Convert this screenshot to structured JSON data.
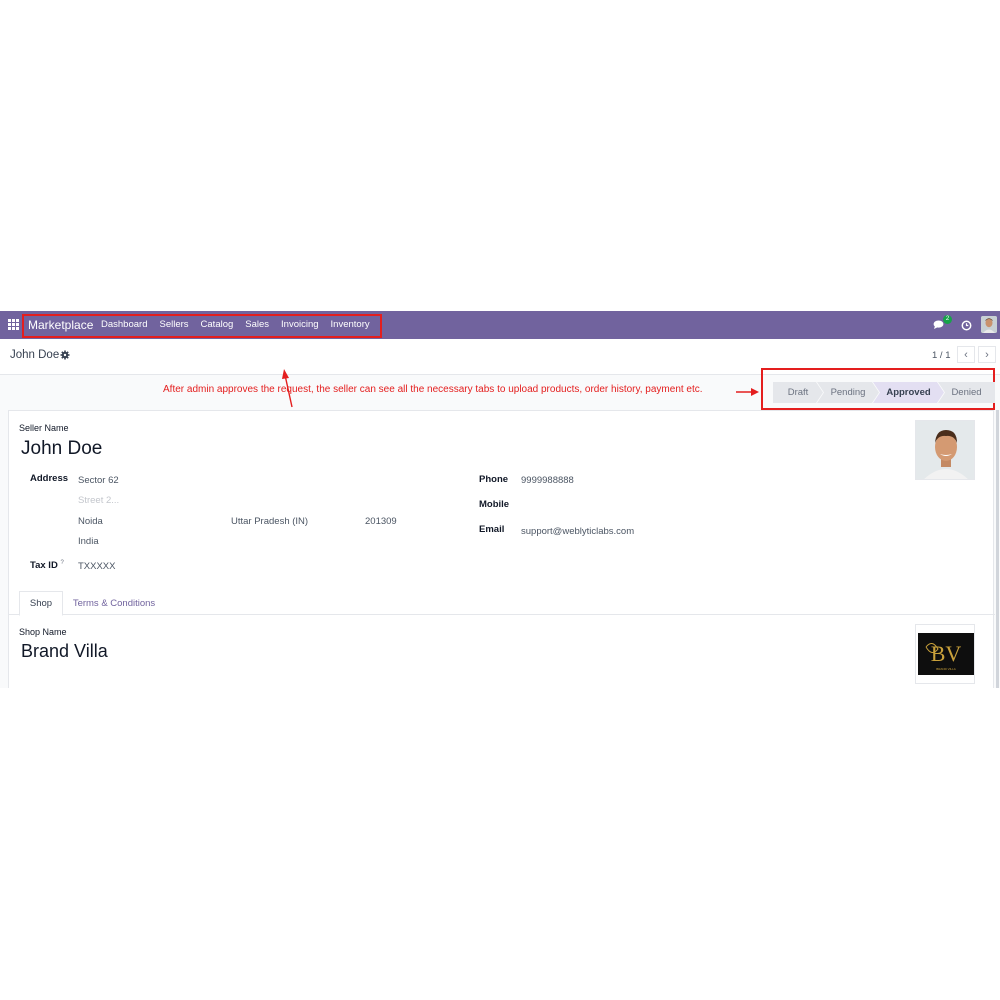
{
  "navbar": {
    "brand": "Marketplace",
    "menu": [
      "Dashboard",
      "Sellers",
      "Catalog",
      "Sales",
      "Invoicing",
      "Inventory"
    ],
    "chat_badge": "2",
    "color": "#71639e"
  },
  "control": {
    "record_title": "John Doe",
    "pager": "1 / 1",
    "prev_icon": "chevron-left-icon",
    "next_icon": "chevron-right-icon"
  },
  "annotation": {
    "text": "After admin approves the request, the seller can see all the necessary tabs to upload products, order history, payment etc.",
    "color": "#e41e1e"
  },
  "status": {
    "stages": [
      "Draft",
      "Pending",
      "Approved",
      "Denied"
    ],
    "current": "Approved"
  },
  "form": {
    "seller_name_label": "Seller Name",
    "seller_name": "John Doe",
    "address_label": "Address",
    "street": "Sector 62",
    "street2_placeholder": "Street 2...",
    "city": "Noida",
    "state": "Uttar Pradesh (IN)",
    "zip": "201309",
    "country": "India",
    "tax_id_label": "Tax ID",
    "tax_id_help": "?",
    "tax_id": "TXXXXX",
    "phone_label": "Phone",
    "phone": "9999988888",
    "mobile_label": "Mobile",
    "email_label": "Email",
    "email": "support@weblyticlabs.com"
  },
  "tabs": [
    "Shop",
    "Terms & Conditions"
  ],
  "shop": {
    "shop_name_label": "Shop Name",
    "shop_name": "Brand Villa",
    "logo_text": "BRAND VILLA"
  }
}
